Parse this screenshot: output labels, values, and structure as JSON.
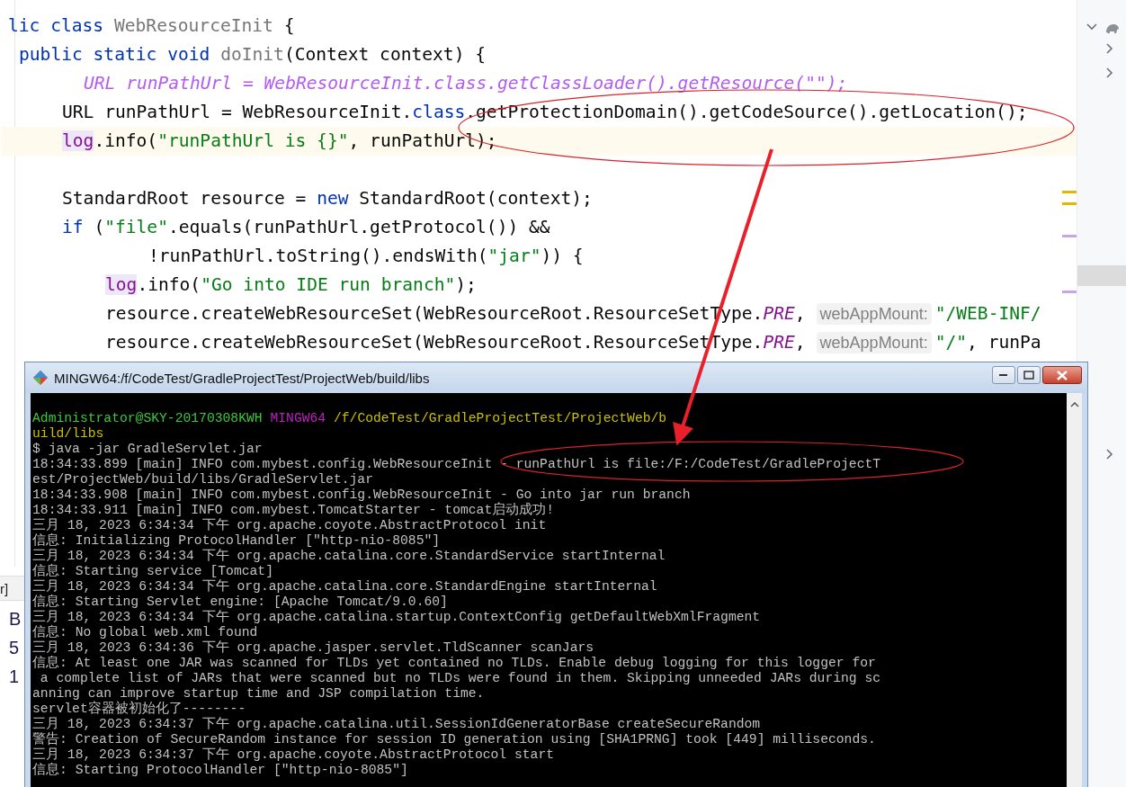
{
  "editor": {
    "lines": [
      {
        "kind": "class",
        "current": false,
        "tokens": [
          {
            "t": "lic ",
            "kind": "kw"
          },
          {
            "t": "class ",
            "kind": "kw"
          },
          {
            "t": "WebResourceInit",
            "kind": "decl"
          },
          {
            "t": " {",
            "kind": "plain"
          }
        ]
      },
      {
        "kind": "method",
        "current": false,
        "tokens": [
          {
            "t": "public static void ",
            "kind": "kw"
          },
          {
            "t": "doInit",
            "kind": "decl"
          },
          {
            "t": "(Context context) {",
            "kind": "plain"
          }
        ]
      },
      {
        "kind": "inlay",
        "current": false,
        "tokens": [
          {
            "t": "URL runPathUrl = WebResourceInit.class.getClassLoader().getResource(\"\");",
            "kind": "italic"
          }
        ]
      },
      {
        "kind": "statement",
        "current": false,
        "tokens": [
          {
            "t": "URL runPathUrl = WebResourceInit.",
            "kind": "plain"
          },
          {
            "t": "class",
            "kind": "kw"
          },
          {
            "t": ".getProtectionDomain().getCodeSource().getLocation();",
            "kind": "plain"
          }
        ]
      },
      {
        "kind": "statement",
        "current": true,
        "tokens": [
          {
            "t": "log",
            "kind": "field"
          },
          {
            "t": ".info(",
            "kind": "plain"
          },
          {
            "t": "\"runPathUrl is {}\"",
            "kind": "str"
          },
          {
            "t": ", runPathUrl);",
            "kind": "plain"
          }
        ]
      },
      {
        "kind": "blank",
        "current": false
      },
      {
        "kind": "statement",
        "current": false,
        "tokens": [
          {
            "t": "StandardRoot resource = ",
            "kind": "plain"
          },
          {
            "t": "new",
            "kind": "kw"
          },
          {
            "t": " StandardRoot(context);",
            "kind": "plain"
          }
        ]
      },
      {
        "kind": "statement",
        "current": false,
        "tokens": [
          {
            "t": "if",
            "kind": "kw"
          },
          {
            "t": " (",
            "kind": "plain"
          },
          {
            "t": "\"file\"",
            "kind": "str"
          },
          {
            "t": ".equals(runPathUrl.getProtocol()) &&",
            "kind": "plain"
          }
        ]
      },
      {
        "kind": "continuation",
        "current": false,
        "tokens": [
          {
            "t": "!runPathUrl.toString().endsWith(",
            "kind": "plain"
          },
          {
            "t": "\"jar\"",
            "kind": "str"
          },
          {
            "t": ")) {",
            "kind": "plain"
          }
        ]
      },
      {
        "kind": "inner",
        "current": false,
        "tokens": [
          {
            "t": "log",
            "kind": "field"
          },
          {
            "t": ".info(",
            "kind": "plain"
          },
          {
            "t": "\"Go into IDE run branch\"",
            "kind": "str"
          },
          {
            "t": ");",
            "kind": "plain"
          }
        ]
      },
      {
        "kind": "inner",
        "current": false,
        "tokens": [
          {
            "t": "resource.createWebResourceSet(WebResourceRoot.ResourceSetType.",
            "kind": "plain"
          },
          {
            "t": "PRE",
            "kind": "static"
          },
          {
            "t": ",",
            "kind": "plain"
          },
          {
            "t": "webAppMount:",
            "kind": "hint"
          },
          {
            "t": "\"/WEB-INF/",
            "kind": "str"
          }
        ]
      },
      {
        "kind": "inner",
        "current": false,
        "tokens": [
          {
            "t": "resource.createWebResourceSet(WebResourceRoot.ResourceSetType.",
            "kind": "plain"
          },
          {
            "t": "PRE",
            "kind": "static"
          },
          {
            "t": ",",
            "kind": "plain"
          },
          {
            "t": "webAppMount:",
            "kind": "hint"
          },
          {
            "t": "\"/\"",
            "kind": "str"
          },
          {
            "t": ", runPa",
            "kind": "plain"
          }
        ]
      }
    ]
  },
  "tool_window": {
    "tab": "r]",
    "lines": [
      "B",
      "5",
      "1"
    ]
  },
  "terminal": {
    "title": "MINGW64:/f/CodeTest/GradleProjectTest/ProjectWeb/build/libs",
    "prompt": {
      "user": "Administrator@SKY-20170308KWH",
      "shell": "MINGW64",
      "path": "/f/CodeTest/GradleProjectTest/ProjectWeb/b",
      "path_continued": "uild/libs"
    },
    "lines": [
      "$ java -jar GradleServlet.jar",
      "18:34:33.899 [main] INFO com.mybest.config.WebResourceInit - runPathUrl is file:/F:/CodeTest/GradleProjectT",
      "est/ProjectWeb/build/libs/GradleServlet.jar",
      "18:34:33.908 [main] INFO com.mybest.config.WebResourceInit - Go into jar run branch",
      "18:34:33.911 [main] INFO com.mybest.TomcatStarter - tomcat启动成功!",
      "三月 18, 2023 6:34:34 下午 org.apache.coyote.AbstractProtocol init",
      "信息: Initializing ProtocolHandler [\"http-nio-8085\"]",
      "三月 18, 2023 6:34:34 下午 org.apache.catalina.core.StandardService startInternal",
      "信息: Starting service [Tomcat]",
      "三月 18, 2023 6:34:34 下午 org.apache.catalina.core.StandardEngine startInternal",
      "信息: Starting Servlet engine: [Apache Tomcat/9.0.60]",
      "三月 18, 2023 6:34:34 下午 org.apache.catalina.startup.ContextConfig getDefaultWebXmlFragment",
      "信息: No global web.xml found",
      "三月 18, 2023 6:34:36 下午 org.apache.jasper.servlet.TldScanner scanJars",
      "信息: At least one JAR was scanned for TLDs yet contained no TLDs. Enable debug logging for this logger for",
      " a complete list of JARs that were scanned but no TLDs were found in them. Skipping unneeded JARs during sc",
      "anning can improve startup time and JSP compilation time.",
      "servlet容器被初始化了--------",
      "三月 18, 2023 6:34:37 下午 org.apache.catalina.util.SessionIdGeneratorBase createSecureRandom",
      "警告: Creation of SecureRandom instance for session ID generation using [SHA1PRNG] took [449] milliseconds.",
      "三月 18, 2023 6:34:37 下午 org.apache.coyote.AbstractProtocol start",
      "信息: Starting ProtocolHandler [\"http-nio-8085\"]"
    ]
  }
}
